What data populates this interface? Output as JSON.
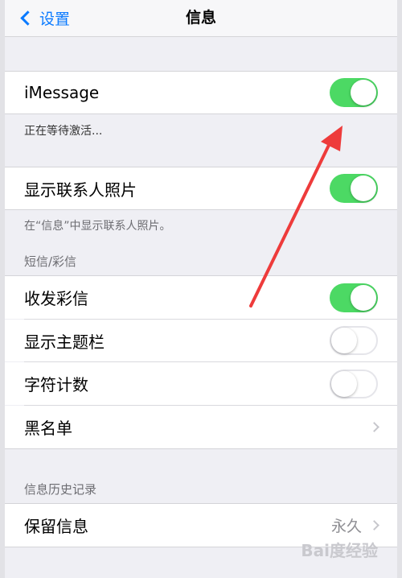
{
  "nav": {
    "back_label": "设置",
    "title": "信息"
  },
  "imessage": {
    "label": "iMessage",
    "status": "正在等待激活..."
  },
  "contact_photos": {
    "label": "显示联系人照片",
    "footer": "在“信息”中显示联系人照片。"
  },
  "sms": {
    "header": "短信/彩信",
    "mms_label": "收发彩信",
    "subject_label": "显示主题栏",
    "char_count_label": "字符计数",
    "blocked_label": "黑名单"
  },
  "history": {
    "header": "信息历史记录",
    "keep_label": "保留信息",
    "keep_value": "永久"
  },
  "watermark": "Bai度经验",
  "colors": {
    "accent": "#0a7aff",
    "toggle_on": "#4cd964",
    "background": "#efeff4"
  },
  "toggles": {
    "imessage": true,
    "contact_photos": true,
    "mms": true,
    "subject": false,
    "char_count": false
  }
}
